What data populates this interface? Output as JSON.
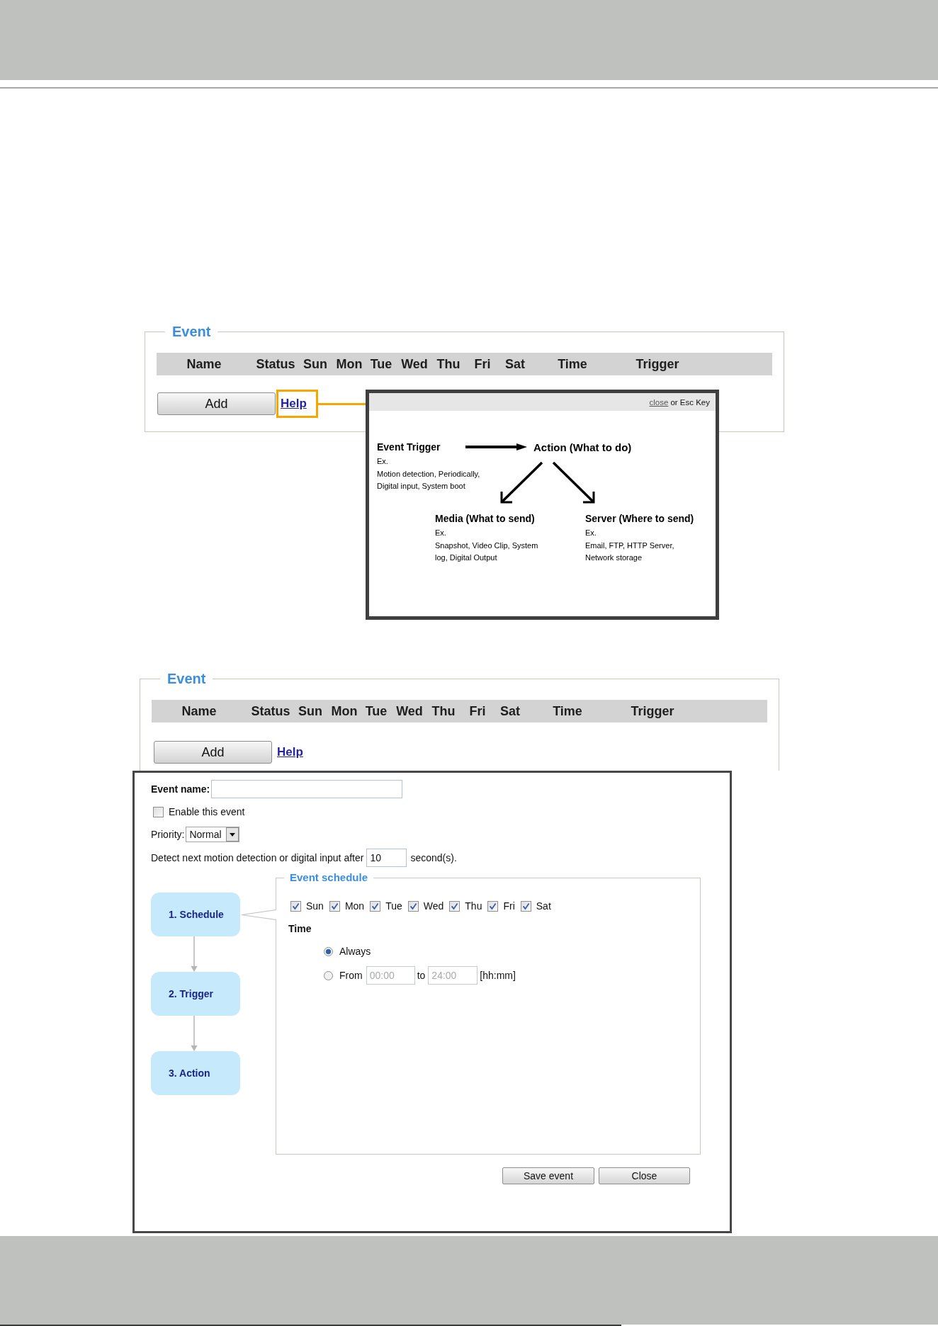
{
  "figure_1": {
    "event_panel": {
      "title": "Event",
      "columns": [
        "Name",
        "Status",
        "Sun",
        "Mon",
        "Tue",
        "Wed",
        "Thu",
        "Fri",
        "Sat",
        "Time",
        "Trigger"
      ],
      "add_button": "Add",
      "help_link": {
        "label": "Help",
        "highlighted": true
      }
    },
    "help_popup": {
      "close_link": "close",
      "close_hint": "or Esc Key",
      "trigger": {
        "title": "Event Trigger",
        "example_label": "Ex.",
        "examples": "Motion detection, Periodically, Digital input, System boot"
      },
      "action": {
        "title": "Action (What to do)"
      },
      "media": {
        "title": "Media (What to send)",
        "example_label": "Ex.",
        "examples": "Snapshot, Video Clip, System log, Digital Output"
      },
      "server": {
        "title": "Server (Where to send)",
        "example_label": "Ex.",
        "examples": "Email, FTP, HTTP Server, Network storage"
      }
    }
  },
  "figure_2": {
    "event_panel": {
      "title": "Event",
      "columns": [
        "Name",
        "Status",
        "Sun",
        "Mon",
        "Tue",
        "Wed",
        "Thu",
        "Fri",
        "Sat",
        "Time",
        "Trigger"
      ],
      "add_button": "Add",
      "help_link": {
        "label": "Help",
        "highlighted": false
      }
    },
    "event_dialog": {
      "event_name": {
        "label": "Event name:"
      },
      "enable": {
        "label": "Enable this event",
        "checked": false
      },
      "priority": {
        "label": "Priority:",
        "value": "Normal"
      },
      "interval": {
        "label": "Detect next motion detection or digital input after",
        "value": "10",
        "unit": "second(s)."
      },
      "steps": [
        {
          "label": "1. Schedule",
          "selected": true
        },
        {
          "label": "2. Trigger",
          "selected": false
        },
        {
          "label": "3. Action",
          "selected": false
        }
      ],
      "schedule": {
        "title": "Event schedule",
        "days": [
          {
            "label": "Sun",
            "checked": true
          },
          {
            "label": "Mon",
            "checked": true
          },
          {
            "label": "Tue",
            "checked": true
          },
          {
            "label": "Wed",
            "checked": true
          },
          {
            "label": "Thu",
            "checked": true
          },
          {
            "label": "Fri",
            "checked": true
          },
          {
            "label": "Sat",
            "checked": true
          }
        ],
        "time_label": "Time",
        "options": [
          {
            "kind": "always",
            "label": "Always",
            "selected": true
          },
          {
            "kind": "range",
            "label": "From",
            "selected": false,
            "from": "00:00",
            "to_label": "to",
            "to": "24:00",
            "format": "[hh:mm]",
            "disabled": true
          }
        ]
      },
      "buttons": [
        "Save event",
        "Close"
      ]
    }
  }
}
